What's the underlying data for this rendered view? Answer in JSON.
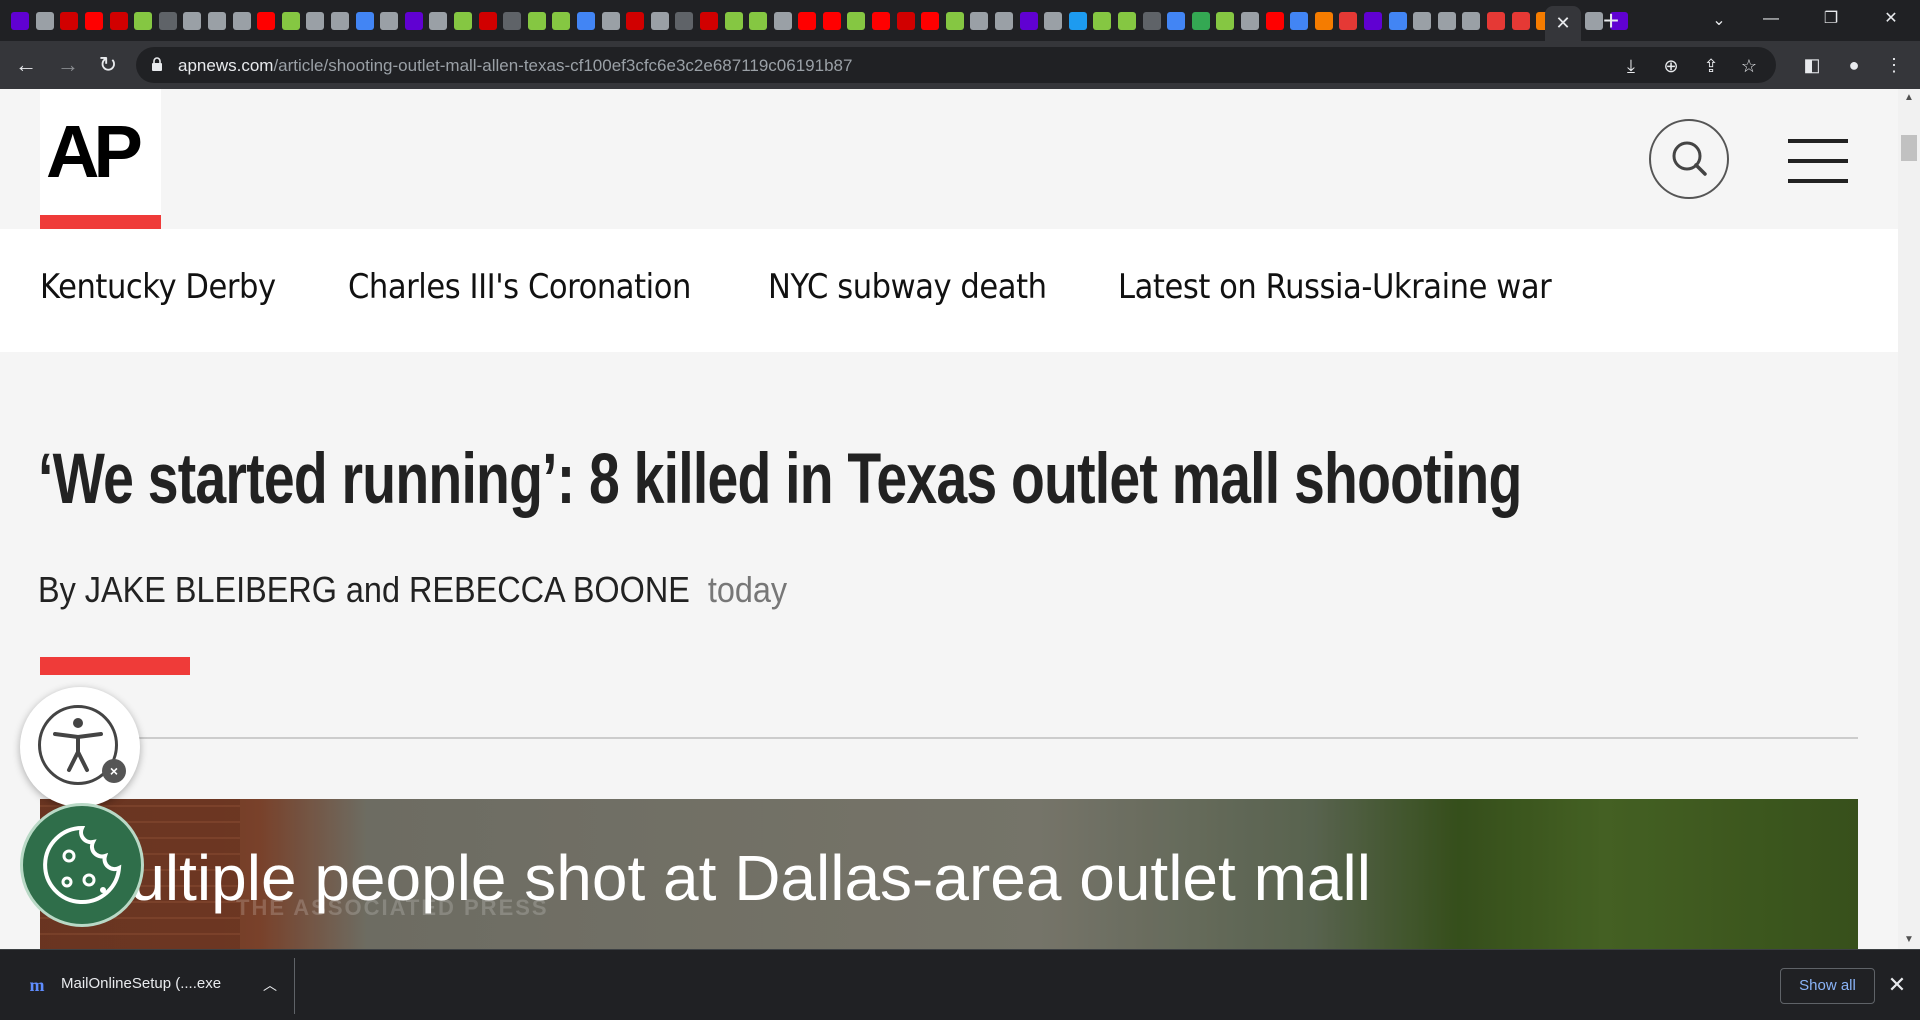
{
  "browser": {
    "tab_favicons": [
      {
        "icon": "yahoo-icon",
        "color": "#6001d2"
      },
      {
        "icon": "globe-icon",
        "color": "#9aa0a6"
      },
      {
        "icon": "business-insider-icon",
        "color": "#d10000"
      },
      {
        "icon": "youtube-icon",
        "color": "#ff0000"
      },
      {
        "icon": "business-insider-icon",
        "color": "#d10000"
      },
      {
        "icon": "rumble-icon",
        "color": "#85c742"
      },
      {
        "icon": "shield-icon",
        "color": "#5f6368"
      },
      {
        "icon": "play-icon",
        "color": "#9aa0a6"
      },
      {
        "icon": "image-icon",
        "color": "#9aa0a6"
      },
      {
        "icon": "globe-icon",
        "color": "#9aa0a6"
      },
      {
        "icon": "youtube-icon",
        "color": "#ff0000"
      },
      {
        "icon": "rumble-icon",
        "color": "#85c742"
      },
      {
        "icon": "globe-icon",
        "color": "#9aa0a6"
      },
      {
        "icon": "play-icon",
        "color": "#9aa0a6"
      },
      {
        "icon": "search-icon",
        "color": "#4285f4"
      },
      {
        "icon": "image-icon",
        "color": "#9aa0a6"
      },
      {
        "icon": "yahoo-icon",
        "color": "#6001d2"
      },
      {
        "icon": "page-icon",
        "color": "#9aa0a6"
      },
      {
        "icon": "rumble-icon",
        "color": "#85c742"
      },
      {
        "icon": "business-insider-icon",
        "color": "#d10000"
      },
      {
        "icon": "shield-icon",
        "color": "#5f6368"
      },
      {
        "icon": "rumble-icon",
        "color": "#85c742"
      },
      {
        "icon": "rumble-icon",
        "color": "#85c742"
      },
      {
        "icon": "search-icon",
        "color": "#4285f4"
      },
      {
        "icon": "play-icon",
        "color": "#9aa0a6"
      },
      {
        "icon": "business-insider-icon",
        "color": "#d10000"
      },
      {
        "icon": "page-icon",
        "color": "#9aa0a6"
      },
      {
        "icon": "page-icon",
        "color": "#5f6368"
      },
      {
        "icon": "business-insider-icon",
        "color": "#d10000"
      },
      {
        "icon": "rumble-icon",
        "color": "#85c742"
      },
      {
        "icon": "rumble-icon",
        "color": "#85c742"
      },
      {
        "icon": "play-icon",
        "color": "#9aa0a6"
      },
      {
        "icon": "youtube-icon",
        "color": "#ff0000"
      },
      {
        "icon": "youtube-icon",
        "color": "#ff0000"
      },
      {
        "icon": "rumble-icon",
        "color": "#85c742"
      },
      {
        "icon": "youtube-icon",
        "color": "#ff0000"
      },
      {
        "icon": "business-insider-icon",
        "color": "#d10000"
      },
      {
        "icon": "youtube-icon",
        "color": "#ff0000"
      },
      {
        "icon": "rumble-icon",
        "color": "#85c742"
      },
      {
        "icon": "page-icon",
        "color": "#9aa0a6"
      },
      {
        "icon": "globe-icon",
        "color": "#9aa0a6"
      },
      {
        "icon": "yahoo-icon",
        "color": "#6001d2"
      },
      {
        "icon": "play-icon",
        "color": "#9aa0a6"
      },
      {
        "icon": "twitter-icon",
        "color": "#1d9bf0"
      },
      {
        "icon": "rumble-icon",
        "color": "#85c742"
      },
      {
        "icon": "rumble-icon",
        "color": "#85c742"
      },
      {
        "icon": "shield-icon",
        "color": "#5f6368"
      },
      {
        "icon": "search-icon",
        "color": "#4285f4"
      },
      {
        "icon": "g-icon",
        "color": "#34a853"
      },
      {
        "icon": "rumble-icon",
        "color": "#85c742"
      },
      {
        "icon": "image-icon",
        "color": "#9aa0a6"
      },
      {
        "icon": "youtube-icon",
        "color": "#ff0000"
      },
      {
        "icon": "search-icon",
        "color": "#4285f4"
      },
      {
        "icon": "bookmark-icon",
        "color": "#f57c00"
      },
      {
        "icon": "fire-icon",
        "color": "#e53935"
      },
      {
        "icon": "yahoo-icon",
        "color": "#6001d2"
      },
      {
        "icon": "search-icon",
        "color": "#4285f4"
      },
      {
        "icon": "globe-icon",
        "color": "#9aa0a6"
      },
      {
        "icon": "globe-icon",
        "color": "#9aa0a6"
      },
      {
        "icon": "page-icon",
        "color": "#9aa0a6"
      },
      {
        "icon": "pin-icon",
        "color": "#e53935"
      },
      {
        "icon": "pin-icon",
        "color": "#e53935"
      },
      {
        "icon": "bookmark-icon",
        "color": "#f57c00"
      },
      {
        "icon": "google-icon",
        "color": "#4285f4"
      },
      {
        "icon": "image-icon",
        "color": "#9aa0a6"
      },
      {
        "icon": "yahoo-icon",
        "color": "#6001d2"
      }
    ],
    "url_host": "apnews.com",
    "url_path": "/article/shooting-outlet-mall-allen-texas-cf100ef3cfc6e3c2e687119c06191b87"
  },
  "site": {
    "logo_text": "AP",
    "accent_color": "#ef3b39"
  },
  "topnav": {
    "items": [
      "Kentucky Derby",
      "Charles III's Coronation",
      "NYC subway death",
      "Latest on Russia-Ukraine war"
    ]
  },
  "article": {
    "headline": "‘We started running’: 8 killed in Texas outlet mall shooting",
    "byline": "By JAKE BLEIBERG and REBECCA BOONE",
    "date": "today",
    "video_caption": "Multiple people shot at Dallas-area outlet mall",
    "video_watermark": "THE ASSOCIATED PRESS"
  },
  "downloads": {
    "file_name": "MailOnlineSetup (....exe",
    "show_all_label": "Show all"
  }
}
